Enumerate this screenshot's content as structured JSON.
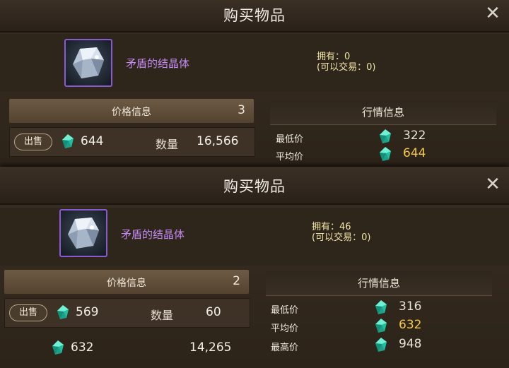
{
  "panels": [
    {
      "title": "购买物品",
      "item_name": "矛盾的结晶体",
      "owned": "拥有：0",
      "tradable": "(可以交易：0)",
      "price_info_label": "价格信息",
      "price_info_count": "3",
      "sell_label": "出售",
      "listing_price": "644",
      "quantity_label": "数量",
      "listing_quantity": "16,566",
      "market_label": "行情信息",
      "lowest_label": "最低价",
      "lowest_value": "322",
      "average_label": "平均价",
      "average_value": "644"
    },
    {
      "title": "购买物品",
      "item_name": "矛盾的结晶体",
      "owned": "拥有：46",
      "tradable": "(可以交易：0)",
      "price_info_label": "价格信息",
      "price_info_count": "2",
      "sell_label": "出售",
      "listing_price": "569",
      "quantity_label": "数量",
      "listing_quantity": "60",
      "listing2_price": "632",
      "listing2_quantity": "14,265",
      "market_label": "行情信息",
      "lowest_label": "最低价",
      "lowest_value": "316",
      "average_label": "平均价",
      "average_value": "632",
      "highest_label": "最高价",
      "highest_value": "948"
    }
  ],
  "colors": {
    "item_name": "#c68cf5",
    "highlight_value": "#f5c84a",
    "gem": "#39d6b8"
  },
  "icons": {
    "close": "close-icon",
    "currency": "gem-icon",
    "item": "crystal-item-icon"
  }
}
